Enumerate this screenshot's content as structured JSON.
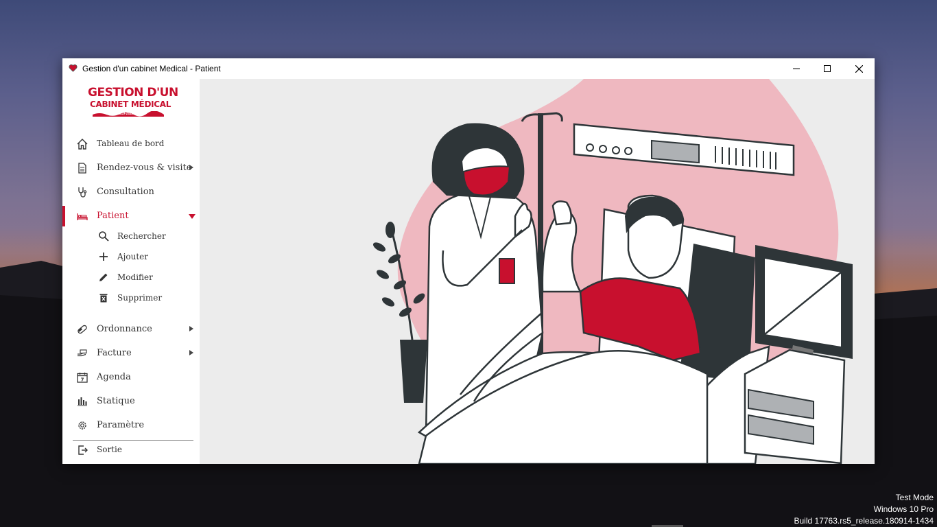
{
  "window": {
    "title": "Gestion d'un cabinet Medical - Patient"
  },
  "logo": {
    "line1": "GESTION D'UN",
    "line2": "CABINET MÉDICAL",
    "year": "2019-2020"
  },
  "nav": {
    "items": [
      {
        "label": "Tableau de bord",
        "icon": "home-icon"
      },
      {
        "label": "Rendez-vous & visite",
        "icon": "document-icon"
      },
      {
        "label": "Consultation",
        "icon": "stethoscope-icon"
      },
      {
        "label": "Patient",
        "icon": "bed-icon"
      },
      {
        "label": "Ordonnance",
        "icon": "pill-icon"
      },
      {
        "label": "Facture",
        "icon": "payment-icon"
      },
      {
        "label": "Agenda",
        "icon": "calendar-icon"
      },
      {
        "label": "Statique",
        "icon": "bar-chart-icon"
      },
      {
        "label": "Paramètre",
        "icon": "gear-icon"
      }
    ],
    "patient_sub": [
      {
        "label": "Rechercher",
        "icon": "search-icon"
      },
      {
        "label": "Ajouter",
        "icon": "plus-icon"
      },
      {
        "label": "Modifier",
        "icon": "pencil-icon"
      },
      {
        "label": "Supprimer",
        "icon": "trash-icon"
      }
    ],
    "exit_label": "Sortie"
  },
  "os_watermark": {
    "line1": "Test Mode",
    "line2": "Windows 10 Pro",
    "line3": "Build 17763.rs5_release.180914-1434"
  },
  "colors": {
    "accent": "#c8102e",
    "illustration_pink": "#efb8c0",
    "illustration_dark": "#2e3538"
  }
}
